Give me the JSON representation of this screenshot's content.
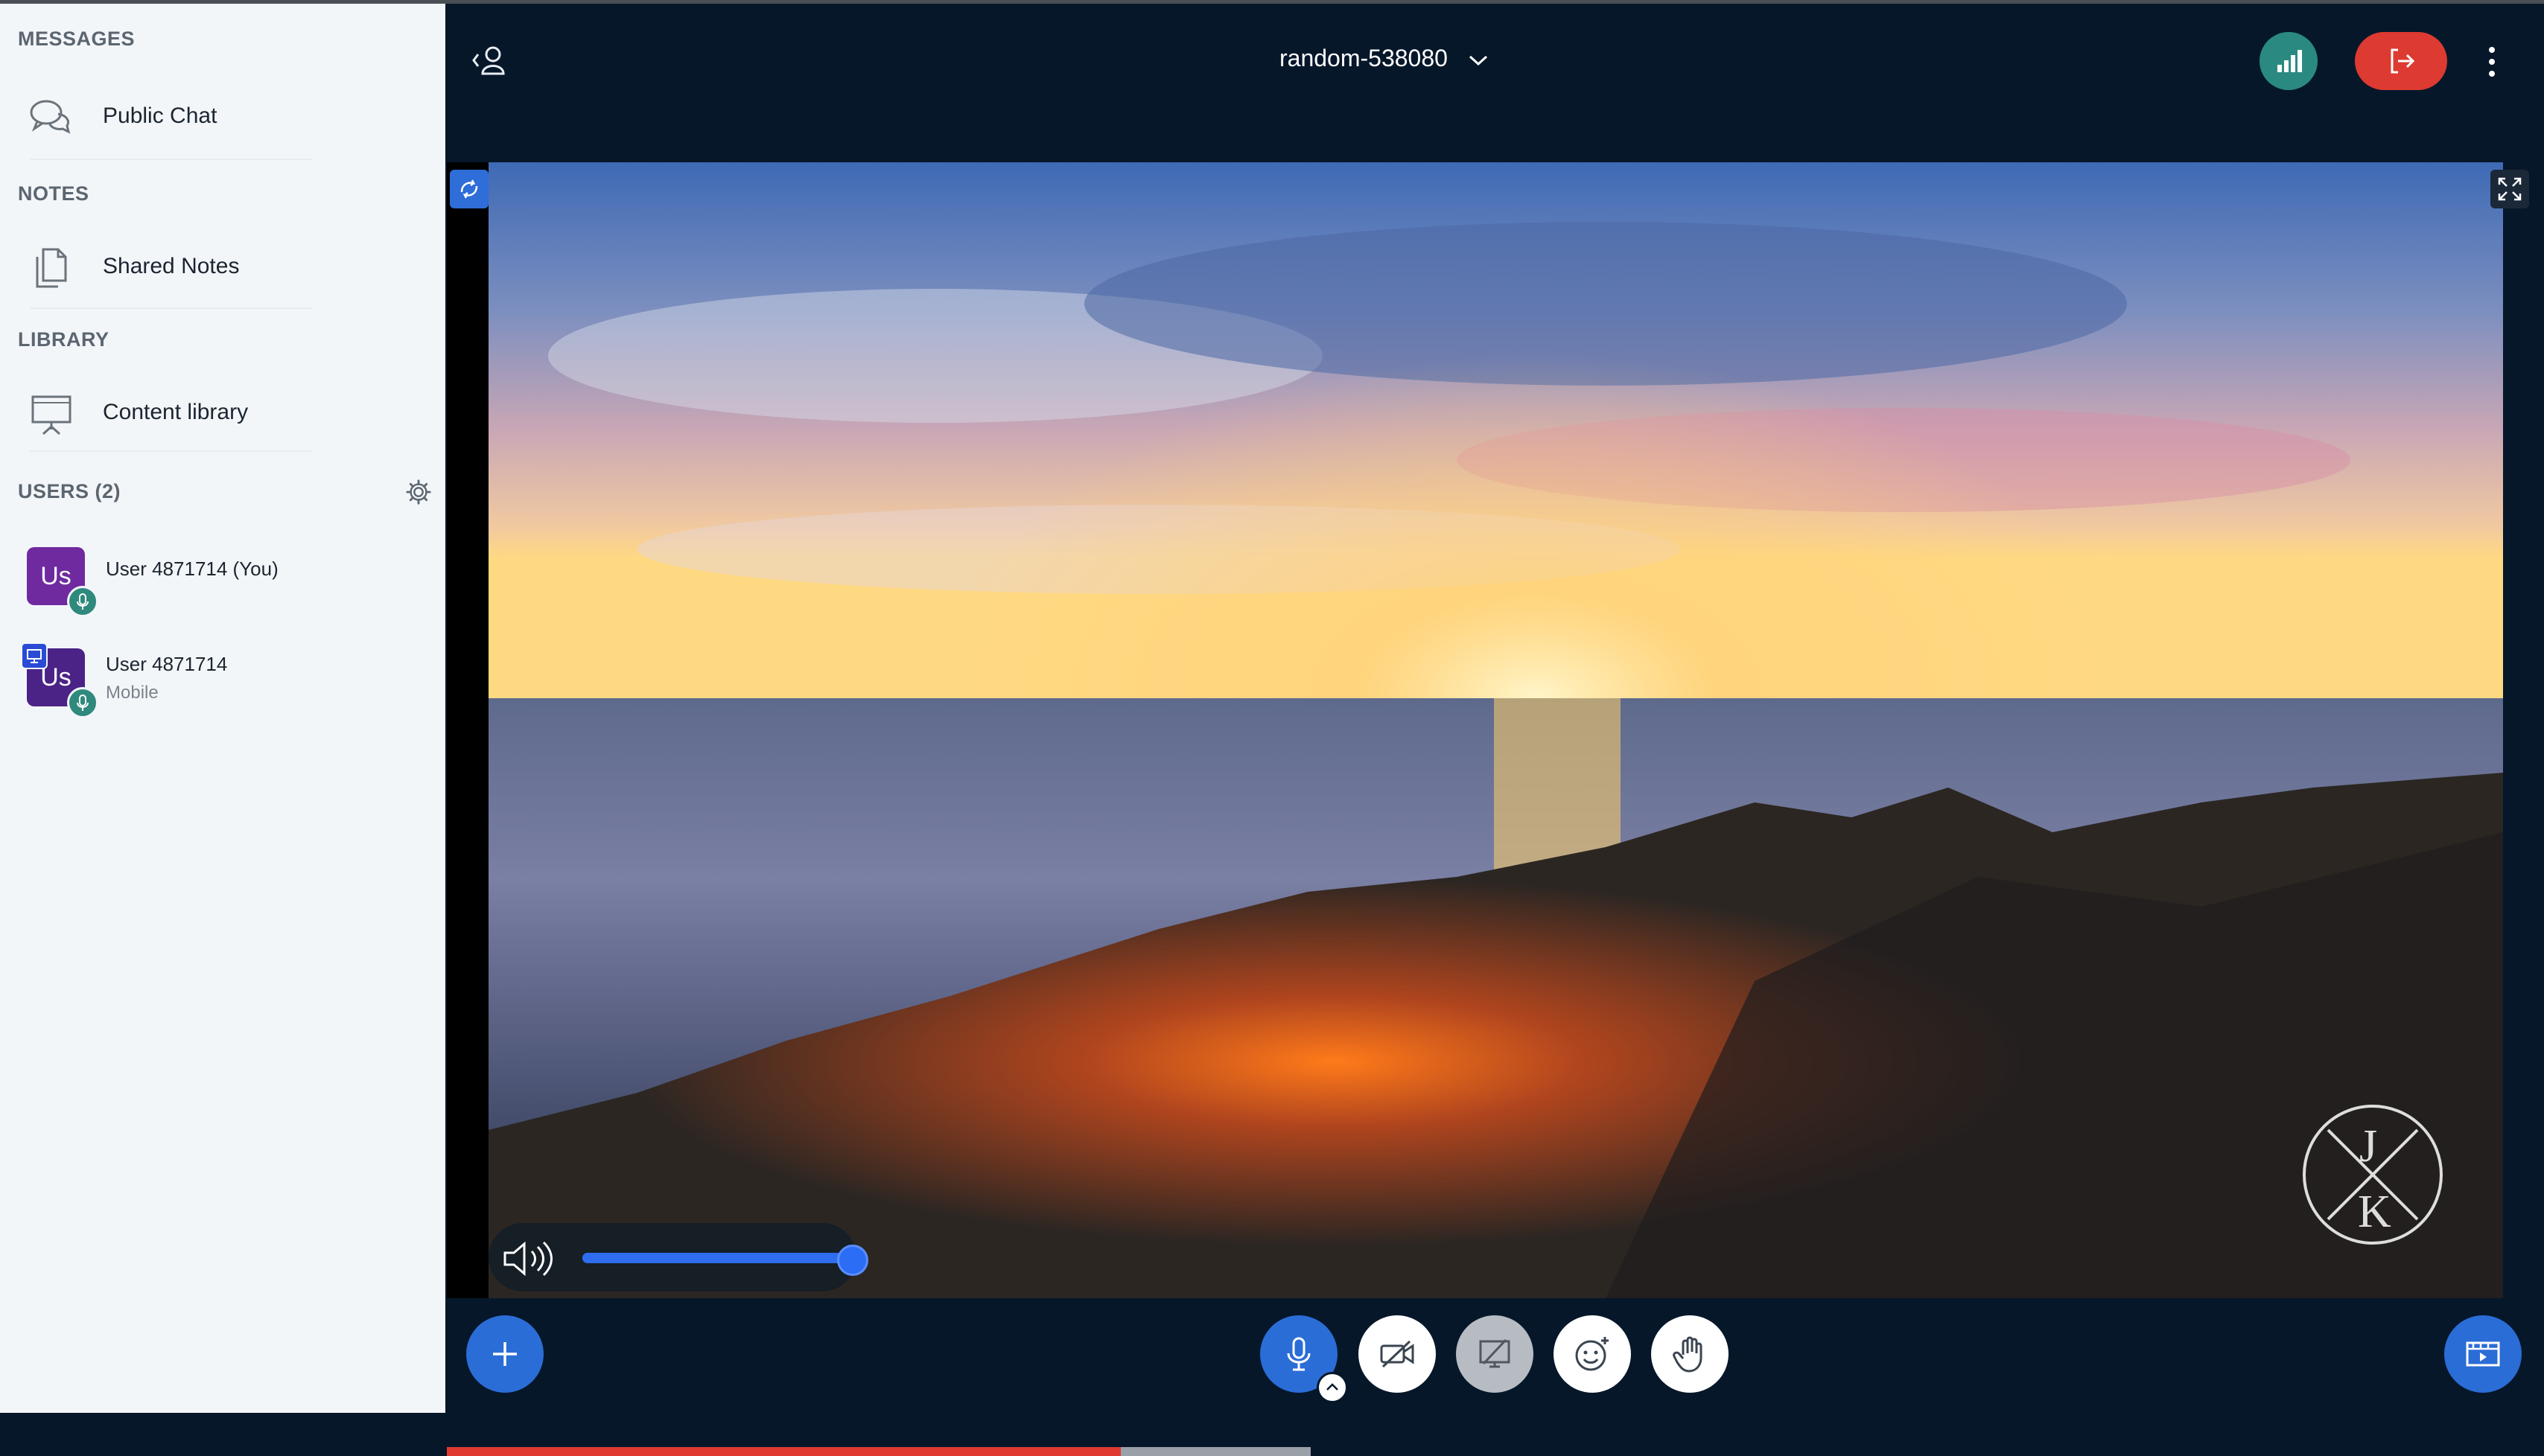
{
  "sidebar": {
    "messages_title": "MESSAGES",
    "public_chat": "Public Chat",
    "notes_title": "NOTES",
    "shared_notes": "Shared Notes",
    "library_title": "LIBRARY",
    "content_library": "Content library",
    "users_title": "USERS (2)",
    "users": [
      {
        "avatar": "Us",
        "name": "User 4871714 (You)",
        "sub": ""
      },
      {
        "avatar": "Us",
        "name": "User 4871714",
        "sub": "Mobile"
      }
    ]
  },
  "header": {
    "room_name": "random-538080"
  },
  "video": {
    "volume_percent": 100,
    "progress_percent": 78
  },
  "icons": {
    "chat": "chat-bubbles-icon",
    "notes": "document-icon",
    "library": "presentation-board-icon",
    "gear": "gear-icon",
    "user_list_toggle": "user-chevron-icon",
    "connection": "signal-bars-icon",
    "leave": "exit-icon",
    "more": "kebab-menu-icon",
    "swap": "swap-icon",
    "fullscreen": "fullscreen-icon",
    "volume": "speaker-icon",
    "plus": "plus-icon",
    "mic": "microphone-icon",
    "camera": "video-off-icon",
    "screenshare": "screenshare-off-icon",
    "reactions": "smiley-icon",
    "raise_hand": "hand-icon",
    "layout": "layout-icon"
  },
  "colors": {
    "accent": "#2b6dd6",
    "leave": "#dd3a31",
    "connection": "#2a8a82",
    "avatar": "#6f2aa0",
    "background": "#06172a"
  }
}
